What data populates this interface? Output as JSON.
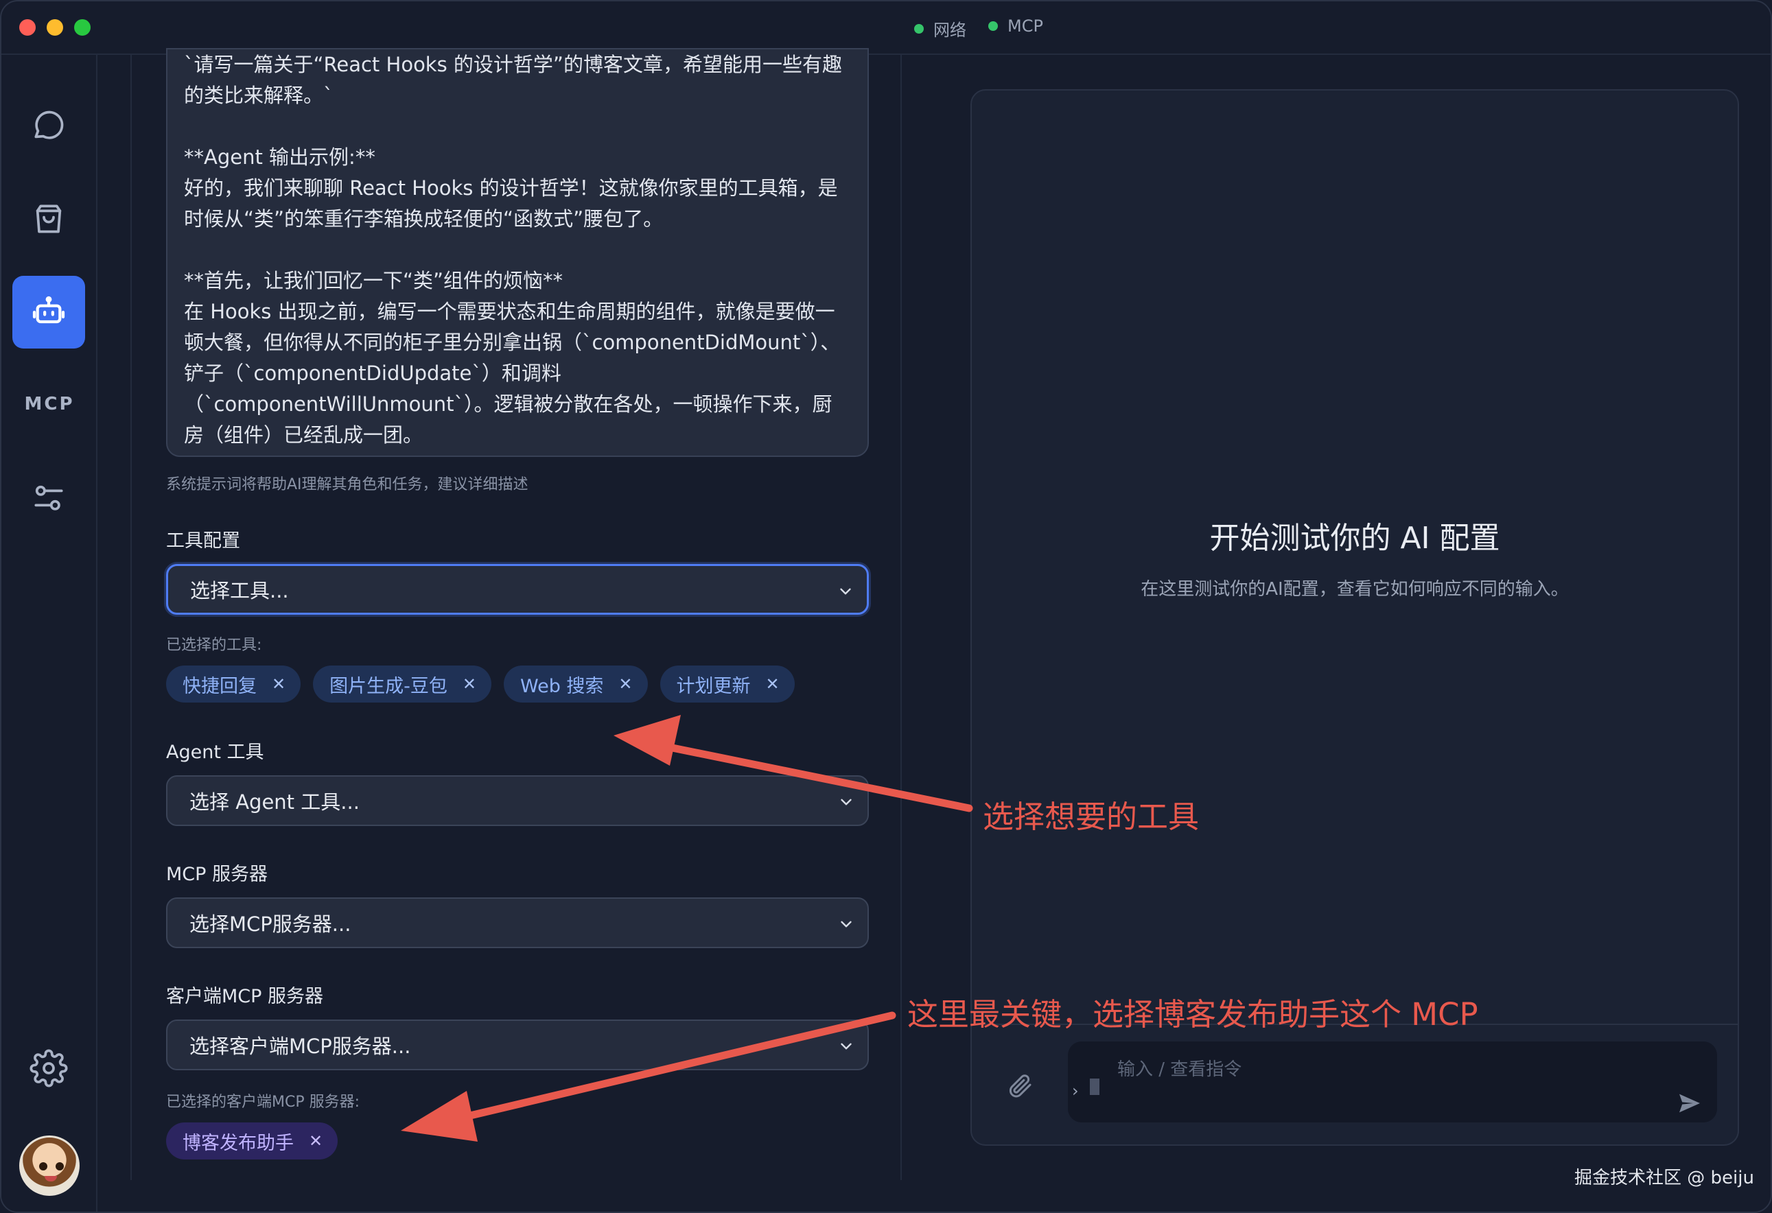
{
  "titlebar": {
    "status": [
      {
        "label": "网络",
        "color": "#35c46a"
      },
      {
        "label": "MCP",
        "color": "#35c46a"
      }
    ]
  },
  "sidebar": {
    "items": [
      {
        "name": "chat",
        "icon": "chat-bubble-icon"
      },
      {
        "name": "store",
        "icon": "shopping-bag-icon"
      },
      {
        "name": "agent",
        "icon": "robot-icon",
        "active": true
      },
      {
        "name": "mcp",
        "label": "MCP"
      },
      {
        "name": "tune",
        "icon": "sliders-icon"
      },
      {
        "name": "settings",
        "icon": "gear-icon"
      }
    ],
    "accent_color": "#3b6df0"
  },
  "prompt": {
    "lines": [
      "`请写一篇关于“React Hooks 的设计哲学”的博客文章，希望能用一些有趣",
      "的类比来解释。`",
      "",
      "**Agent 输出示例:**",
      "好的，我们来聊聊 React Hooks 的设计哲学！这就像你家里的工具箱，是",
      "时候从“类”的笨重行李箱换成轻便的“函数式”腰包了。",
      "",
      "**首先，让我们回忆一下“类”组件的烦恼**",
      "在 Hooks 出现之前，编写一个需要状态和生命周期的组件，就像是要做一",
      "顿大餐，但你得从不同的柜子里分别拿出锅（`componentDidMount`）、",
      "铲子（`componentDidUpdate`）和调料",
      "（`componentWillUnmount`）。逻辑被分散在各处，一顿操作下来，厨",
      "房（组件）已经乱成一团。"
    ],
    "hint": "系统提示词将帮助AI理解其角色和任务，建议详细描述"
  },
  "tools": {
    "label": "工具配置",
    "placeholder": "选择工具...",
    "selected_label": "已选择的工具:",
    "selected": [
      "快捷回复",
      "图片生成-豆包",
      "Web 搜索",
      "计划更新"
    ]
  },
  "agent_tools": {
    "label": "Agent 工具",
    "placeholder": "选择 Agent 工具..."
  },
  "mcp_servers": {
    "label": "MCP 服务器",
    "placeholder": "选择MCP服务器..."
  },
  "client_mcp": {
    "label": "客户端MCP 服务器",
    "placeholder": "选择客户端MCP服务器...",
    "selected_label": "已选择的客户端MCP 服务器:",
    "selected": [
      "博客发布助手"
    ]
  },
  "preview": {
    "title": "开始测试你的 AI 配置",
    "subtitle": "在这里测试你的AI配置，查看它如何响应不同的输入。",
    "input_placeholder": "输入 / 查看指令",
    "caret": "›"
  },
  "annotations": {
    "tools_note": "选择想要的工具",
    "mcp_note": "这里最关键，选择博客发布助手这个 MCP",
    "color": "#e8594d"
  },
  "watermark": "掘金技术社区 @ beiju"
}
